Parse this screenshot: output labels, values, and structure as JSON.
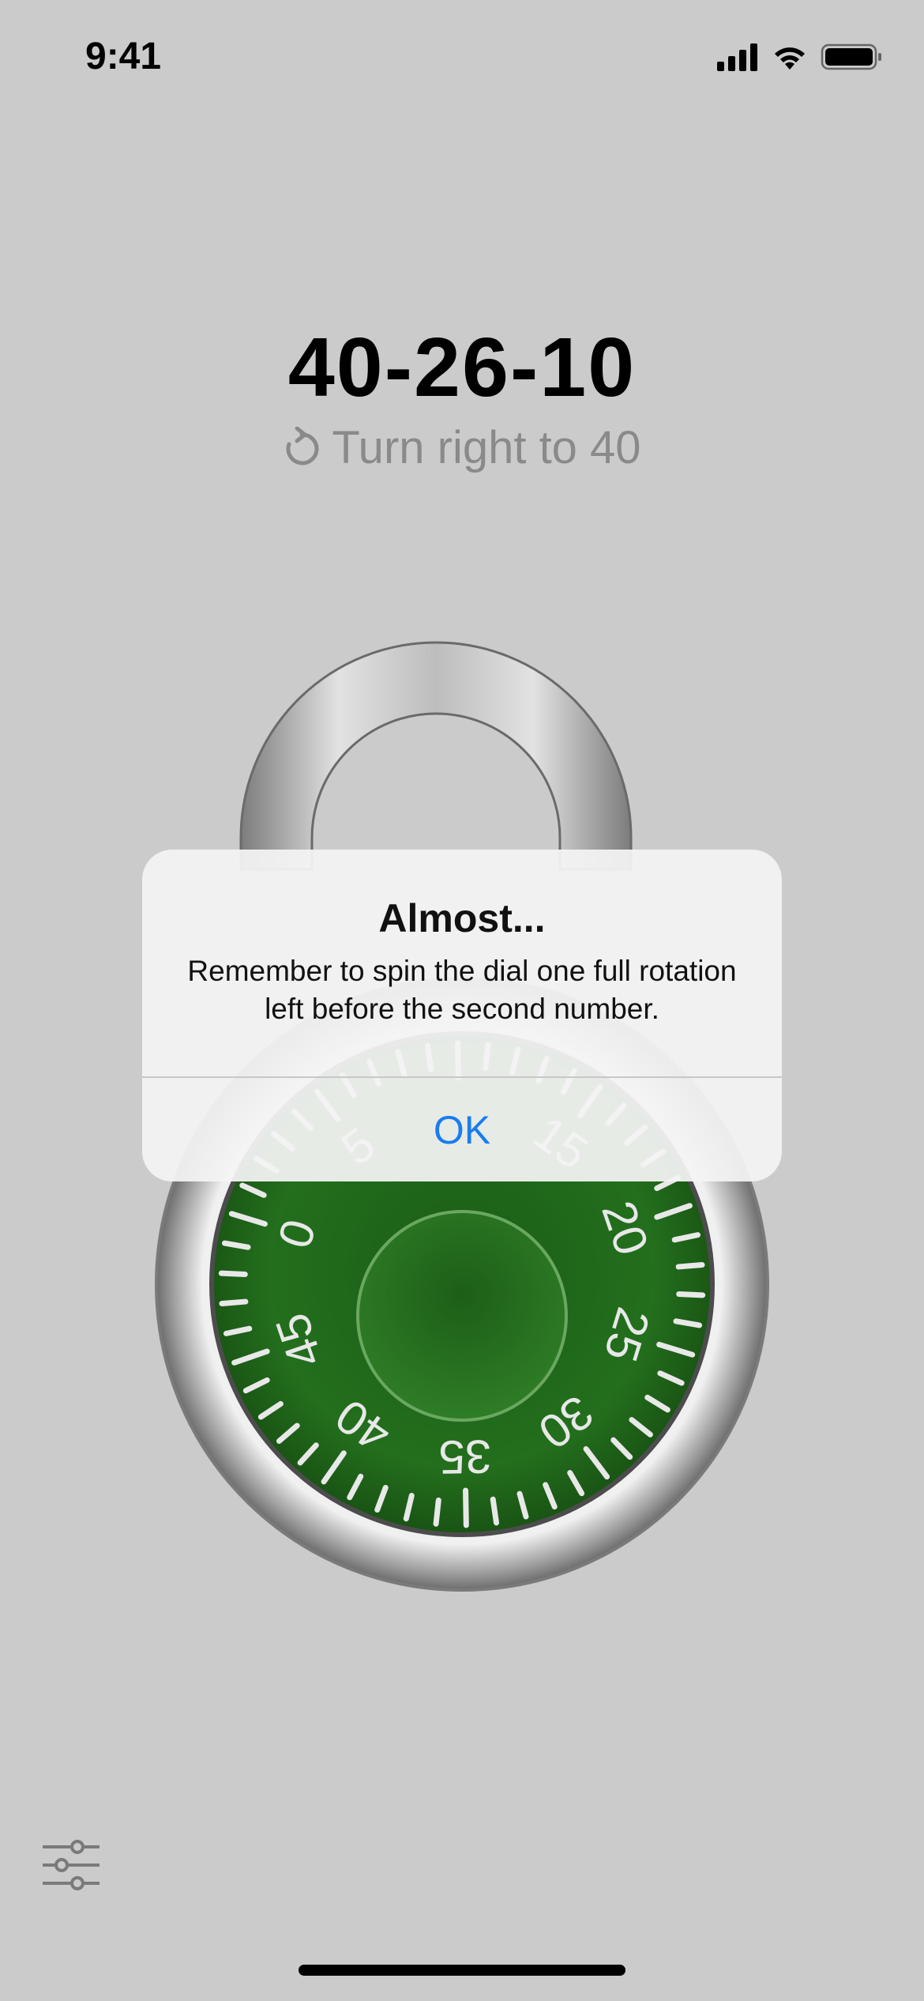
{
  "status_bar": {
    "time": "9:41",
    "icons": [
      "cellular-signal-icon",
      "wifi-icon",
      "battery-icon"
    ]
  },
  "combination": "40-26-10",
  "instruction": {
    "icon": "rotate-clockwise-icon",
    "text": "Turn right to 40"
  },
  "dial": {
    "face_color": "#1f6b1a",
    "visible_numbers": [
      "0",
      "5",
      "15",
      "20",
      "25",
      "30",
      "35",
      "40",
      "45"
    ]
  },
  "alert": {
    "title": "Almost...",
    "message": "Remember to spin the dial one full rotation left before the second number.",
    "button_label": "OK",
    "button_color": "#1a7cf0"
  },
  "toolbar": {
    "settings_icon": "sliders-icon"
  }
}
